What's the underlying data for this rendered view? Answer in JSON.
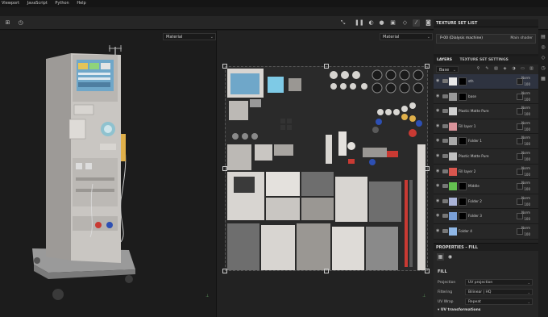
{
  "menu": [
    "Viewport",
    "JavaScript",
    "Python",
    "Help"
  ],
  "viewport_left": {
    "material_select": "Material"
  },
  "viewport_right": {
    "material_select": "Material"
  },
  "texture_set_list": {
    "title": "TEXTURE SET LIST",
    "item": "P-00 (Dialysis machine)",
    "shader": "Main shader"
  },
  "tabs": {
    "layers": "LAYERS",
    "settings": "TEXTURE SET SETTINGS"
  },
  "channel_select": "Base color",
  "layers": [
    {
      "name": "sth",
      "blend": "Norm",
      "opacity": "100",
      "thumb": "#e8e8e8",
      "mask": true
    },
    {
      "name": "base",
      "blend": "Norm",
      "opacity": "100",
      "thumb": "#9a9a9a",
      "mask": true
    },
    {
      "name": "Plastic Matte Pure",
      "blend": "Norm",
      "opacity": "100",
      "thumb": "#cfcfcf",
      "mask": false
    },
    {
      "name": "Fill layer 1",
      "blend": "Norm",
      "opacity": "100",
      "thumb": "#d9939a",
      "mask": false
    },
    {
      "name": "Folder 1",
      "blend": "Norm",
      "opacity": "100",
      "thumb": "#aaaaaa",
      "mask": true
    },
    {
      "name": "Plastic Matte Pure",
      "blend": "Norm",
      "opacity": "100",
      "thumb": "#bfbfbf",
      "mask": false
    },
    {
      "name": "Fill layer 2",
      "blend": "Norm",
      "opacity": "100",
      "thumb": "#d9564e",
      "mask": false
    },
    {
      "name": "Middle",
      "blend": "Norm",
      "opacity": "100",
      "thumb": "#64c150",
      "mask": true
    },
    {
      "name": "Folder 2",
      "blend": "Norm",
      "opacity": "100",
      "thumb": "#aab4d8",
      "mask": true
    },
    {
      "name": "Folder 3",
      "blend": "Norm",
      "opacity": "100",
      "thumb": "#7aa0d8",
      "mask": true
    },
    {
      "name": "Folder 4",
      "blend": "Norm",
      "opacity": "100",
      "thumb": "#8fb7e6",
      "mask": false
    }
  ],
  "properties": {
    "title": "PROPERTIES - FILL",
    "section": "FILL",
    "projection_label": "Projection",
    "projection_value": "UV projection",
    "filtering_label": "Filtering",
    "filtering_value": "Bilinear | HQ",
    "uvwrap_label": "UV Wrap",
    "uvwrap_value": "Repeat",
    "uv_transform": "UV transformations"
  },
  "colors": {
    "accent": "#4a8fe0",
    "selected_row": "#2e3340"
  }
}
